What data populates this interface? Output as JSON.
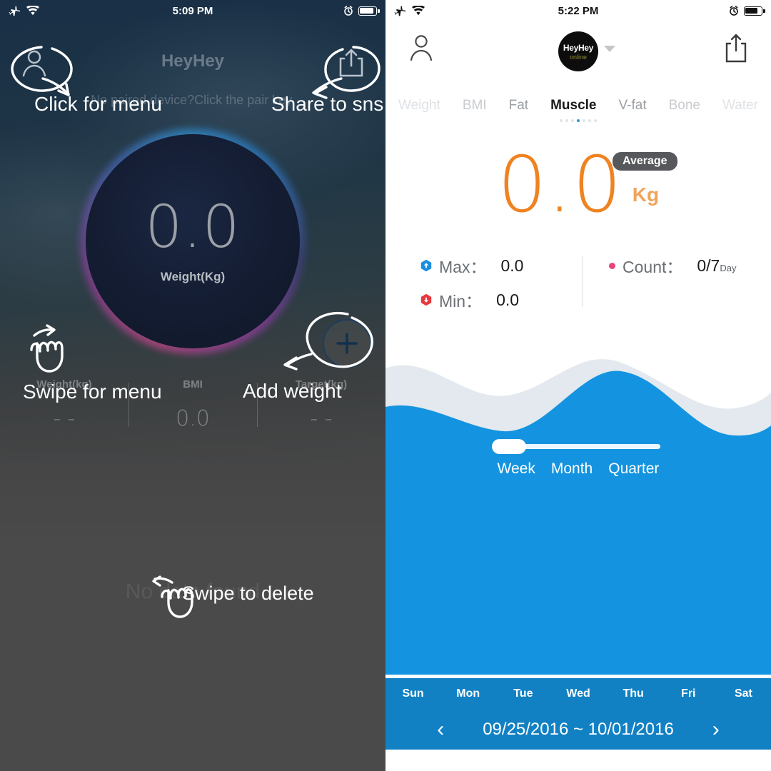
{
  "left": {
    "status": {
      "time": "5:09 PM",
      "airplane_icon": "airplane-icon",
      "wifi_icon": "wifi-icon",
      "alarm_icon": "alarm-clock-icon",
      "battery_icon": "battery-icon"
    },
    "app_title": "HeyHey",
    "subtitle": "No paired device?Click the pair key.",
    "menu_icon": "person-icon",
    "share_icon": "share-icon",
    "weight": {
      "value": "0.0",
      "unit": "Weight(Kg)"
    },
    "add_button_icon": "plus-icon",
    "stats": [
      {
        "label": "Weight(kg)",
        "value": "- -"
      },
      {
        "label": "BMI",
        "value": "0.0"
      },
      {
        "label": "Target(kg)",
        "value": "- -"
      }
    ],
    "empty_text": "No data found",
    "annotations": {
      "menu": "Click for menu",
      "share": "Share to sns",
      "swipe": "Swipe for menu",
      "add": "Add weight",
      "delete": "Swipe to delete"
    }
  },
  "right": {
    "status": {
      "time": "5:22 PM",
      "airplane_icon": "airplane-icon",
      "wifi_icon": "wifi-icon",
      "alarm_icon": "alarm-clock-icon",
      "battery_icon": "battery-icon"
    },
    "profile_icon": "person-icon",
    "share_icon": "share-icon",
    "avatar": {
      "name": "HeyHey",
      "status": "online",
      "caret_icon": "chevron-down-icon"
    },
    "tabs": [
      {
        "label": "Weight",
        "state": "faint"
      },
      {
        "label": "BMI",
        "state": "dim"
      },
      {
        "label": "Fat",
        "state": "dim2"
      },
      {
        "label": "Muscle",
        "state": "active"
      },
      {
        "label": "V-fat",
        "state": "dim2"
      },
      {
        "label": "Bone",
        "state": "dim"
      },
      {
        "label": "Water",
        "state": "faint"
      }
    ],
    "page_dots": {
      "count": 7,
      "active_index": 3
    },
    "reading": {
      "value": "0.0",
      "unit": "Kg",
      "badge": "Average"
    },
    "stats": {
      "max": {
        "label": "Max：",
        "value": "0.0",
        "icon": "hexagon-up-icon",
        "color": "#1a8fe0"
      },
      "min": {
        "label": "Min：",
        "value": "0.0",
        "icon": "hexagon-down-icon",
        "color": "#e8383f"
      },
      "count": {
        "label": "Count：",
        "value": "0/7",
        "suffix": "Day",
        "icon": "dot-icon",
        "color": "#e8437e"
      }
    },
    "range_slider": {
      "selected": "Week",
      "options": [
        "Week",
        "Month",
        "Quarter"
      ]
    },
    "days": [
      "Sun",
      "Mon",
      "Tue",
      "Wed",
      "Thu",
      "Fri",
      "Sat"
    ],
    "date_range": "09/25/2016 ~ 10/01/2016",
    "prev_icon": "chevron-left-icon",
    "next_icon": "chevron-right-icon"
  },
  "colors": {
    "accent_blue": "#1494e0",
    "accent_orange": "#ef8321",
    "dark_navy": "#123150",
    "scrim_gray": "#4a4a4a",
    "bar_blue": "#1181c4"
  }
}
